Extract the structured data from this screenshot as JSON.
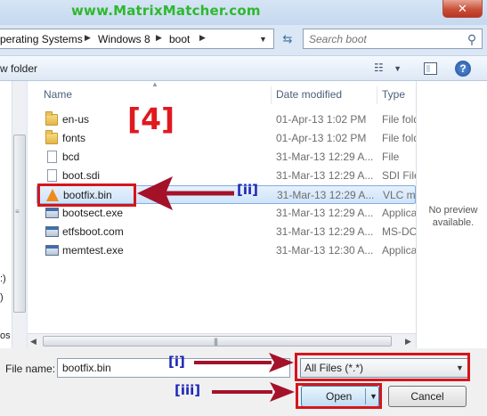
{
  "watermark": "www.MatrixMatcher.com",
  "window": {
    "close_glyph": "✕"
  },
  "address": {
    "crumbs": [
      "perating Systems",
      "Windows 8",
      "boot"
    ],
    "separator_glyph": "▶",
    "dropdown_glyph": "▼"
  },
  "search": {
    "placeholder": "Search boot"
  },
  "toolbar": {
    "new_folder": "w folder"
  },
  "nav_fragments": [
    ":)",
    ")",
    "os"
  ],
  "columns": {
    "name": "Name",
    "date": "Date modified",
    "type": "Type"
  },
  "files": [
    {
      "name": "en-us",
      "date": "01-Apr-13 1:02 PM",
      "type": "File fold",
      "icon": "folder-icon"
    },
    {
      "name": "fonts",
      "date": "01-Apr-13 1:02 PM",
      "type": "File fold",
      "icon": "folder-icon"
    },
    {
      "name": "bcd",
      "date": "31-Mar-13 12:29 A...",
      "type": "File",
      "icon": "file-icon"
    },
    {
      "name": "boot.sdi",
      "date": "31-Mar-13 12:29 A...",
      "type": "SDI File",
      "icon": "file-icon"
    },
    {
      "name": "bootfix.bin",
      "date": "31-Mar-13 12:29 A...",
      "type": "VLC me",
      "icon": "vlc-icon",
      "selected": true
    },
    {
      "name": "bootsect.exe",
      "date": "31-Mar-13 12:29 A...",
      "type": "Applica",
      "icon": "exe-icon"
    },
    {
      "name": "etfsboot.com",
      "date": "31-Mar-13 12:29 A...",
      "type": "MS-DO",
      "icon": "exe-icon"
    },
    {
      "name": "memtest.exe",
      "date": "31-Mar-13 12:30 A...",
      "type": "Applica",
      "icon": "exe-icon"
    }
  ],
  "preview": {
    "text": "No preview available."
  },
  "bottom": {
    "file_name_label": "File name:",
    "file_name_value": "bootfix.bin",
    "file_type": "All Files (*.*)",
    "open": "Open",
    "cancel": "Cancel"
  },
  "annotations": {
    "step": "[4]",
    "label_i": "[i]",
    "label_ii": "[ii]",
    "label_iii": "[iii]",
    "color_red": "#d4161c",
    "color_blue": "#1d27b8"
  }
}
